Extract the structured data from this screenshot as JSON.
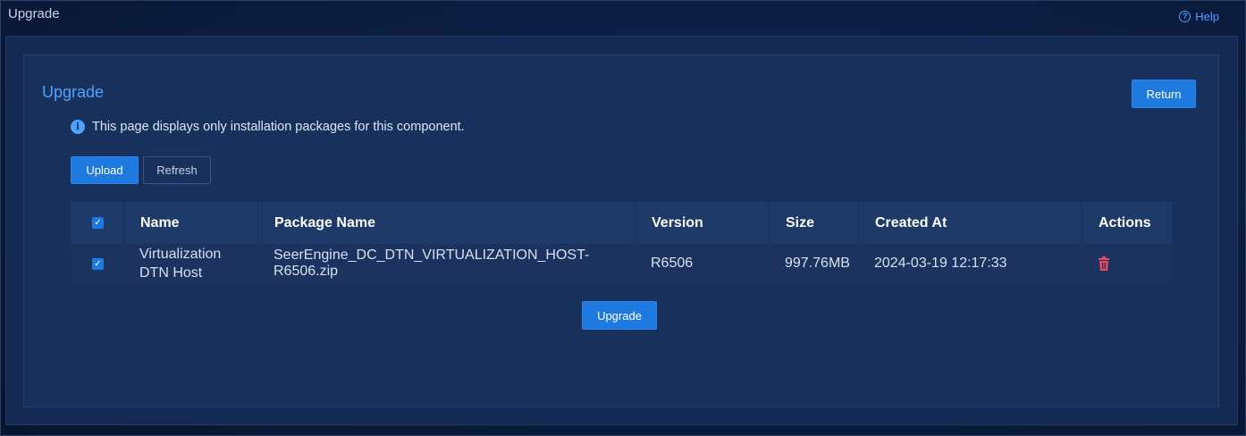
{
  "header": {
    "title": "Upgrade",
    "help_label": "Help",
    "help_icon": "question-circle-icon"
  },
  "panel": {
    "title": "Upgrade",
    "return_label": "Return",
    "notice": "This page displays only installation packages for this component.",
    "upload_label": "Upload",
    "refresh_label": "Refresh",
    "upgrade_label": "Upgrade"
  },
  "table": {
    "columns": [
      "Name",
      "Package Name",
      "Version",
      "Size",
      "Created At",
      "Actions"
    ],
    "rows": [
      {
        "checked": true,
        "name": "Virtualization DTN Host",
        "package_name": "SeerEngine_DC_DTN_VIRTUALIZATION_HOST-R6506.zip",
        "version": "R6506",
        "size": "997.76MB",
        "created_at": "2024-03-19 12:17:33",
        "action_icon": "trash-icon"
      }
    ],
    "header_checked": true
  },
  "colors": {
    "accent": "#1f7ae0",
    "link": "#4ea3ff",
    "danger": "#e84a5f",
    "background": "#0a1a3a"
  }
}
